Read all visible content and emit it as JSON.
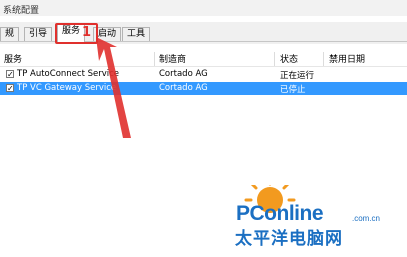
{
  "window": {
    "title": "系统配置"
  },
  "tabs": [
    {
      "label": "规"
    },
    {
      "label": "引导"
    },
    {
      "label": "服务"
    },
    {
      "label": "启动"
    },
    {
      "label": "工具"
    }
  ],
  "annotation": {
    "number": "1",
    "color": "#e0302d"
  },
  "columns": {
    "service": "服务",
    "manufacturer": "制造商",
    "status": "状态",
    "disabled_date": "禁用日期"
  },
  "rows": [
    {
      "checked": true,
      "check_glyph": "✓",
      "service": "TP AutoConnect Service",
      "manufacturer": "Cortado AG",
      "status": "正在运行",
      "disabled_date": ""
    },
    {
      "checked": true,
      "check_glyph": "✓",
      "service": "TP VC Gateway Service",
      "manufacturer": "Cortado AG",
      "status": "已停止",
      "disabled_date": ""
    }
  ],
  "selection_color": "#3399ff",
  "watermark": {
    "brand": "PConline",
    "domain": ".com.cn",
    "chinese": "太平洋电脑网"
  }
}
